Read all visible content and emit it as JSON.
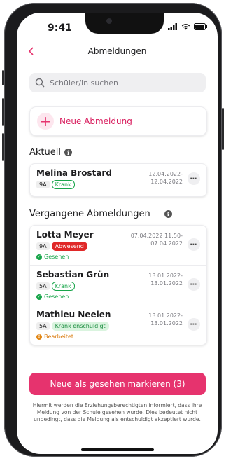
{
  "status_bar": {
    "time": "9:41"
  },
  "header": {
    "back_icon": "chevron-left",
    "title": "Abmeldungen"
  },
  "search": {
    "placeholder": "Schüler/in suchen"
  },
  "new_absence": {
    "label": "Neue Abmeldung"
  },
  "current": {
    "title": "Aktuell",
    "items": [
      {
        "name": "Melina Brostard",
        "class": "9A",
        "tag": "Krank",
        "date_from": "12.04.2022-",
        "date_to": "12.04.2022"
      }
    ]
  },
  "past": {
    "title": "Vergangene Abmeldungen",
    "items": [
      {
        "name": "Lotta Meyer",
        "class": "9A",
        "tag": "Abwesend",
        "date_from": "07.04.2022 11:50-",
        "date_to": "07.04.2022",
        "status": "Gesehen"
      },
      {
        "name": "Sebastian Grün",
        "class": "5A",
        "tag": "Krank",
        "date_from": "13.01.2022-",
        "date_to": "13.01.2022",
        "status": "Gesehen"
      },
      {
        "name": "Mathieu Neelen",
        "class": "5A",
        "tag": "Krank enschuldigt",
        "date_from": "13.01.2022-",
        "date_to": "13.01.2022",
        "status": "Bearbeitet"
      }
    ]
  },
  "cta": {
    "label": "Neue als gesehen markieren (3)"
  },
  "footer_note": "Hiermit werden die Erziehungsberechtigten informiert, dass ihre Meldung von der Schule gesehen wurde. Dies bedeutet nicht unbedingt, dass die Meldung als entschuldigt akzeptiert wurde.",
  "colors": {
    "accent": "#e6336e",
    "green": "#18a54a",
    "red": "#e02828",
    "orange": "#e28613"
  }
}
